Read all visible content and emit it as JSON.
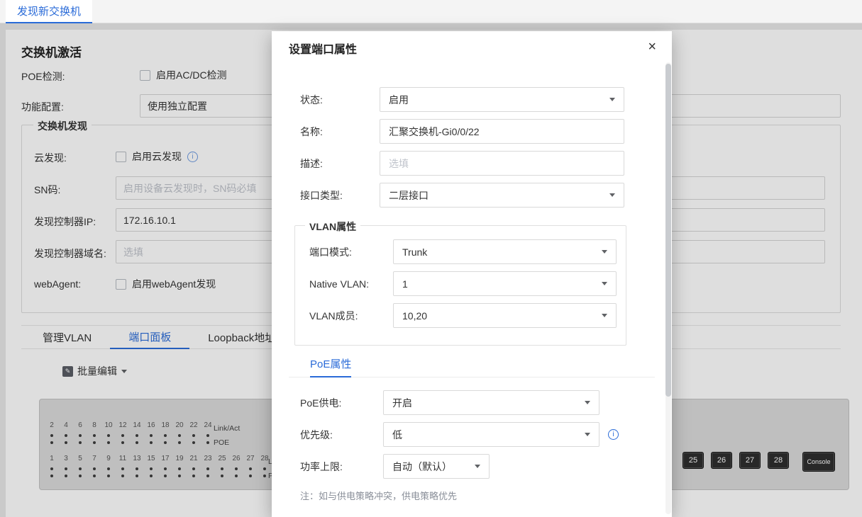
{
  "colors": {
    "accent": "#2a6bd8"
  },
  "icons": {
    "info_glyph": "i",
    "edit_glyph": "✎"
  },
  "topbar": {
    "tab_label": "发现新交换机"
  },
  "page": {
    "title": "交换机激活",
    "rows": {
      "poe": {
        "label": "POE检测:",
        "checkbox_label": "启用AC/DC检测"
      },
      "func": {
        "label": "功能配置:",
        "value": "使用独立配置"
      },
      "cloud": {
        "label": "云发现:",
        "checkbox_label": "启用云发现"
      },
      "sn": {
        "label": "SN码:",
        "placeholder": "启用设备云发现时，SN码必填"
      },
      "controller_ip": {
        "label": "发现控制器IP:",
        "value": "172.16.10.1"
      },
      "controller_domain": {
        "label": "发现控制器域名:",
        "placeholder": "选填"
      },
      "webagent": {
        "label": "webAgent:",
        "checkbox_label": "启用webAgent发现"
      }
    },
    "discovery_legend": "交换机发现",
    "tabs": [
      {
        "label": "管理VLAN"
      },
      {
        "label": "端口面板"
      },
      {
        "label": "Loopback地址"
      }
    ],
    "active_tab": "端口面板",
    "bulk_edit_label": "批量编辑",
    "port_panel": {
      "top_ports": [
        "2",
        "4",
        "6",
        "8",
        "10",
        "12",
        "14",
        "16",
        "18",
        "20",
        "22",
        "24"
      ],
      "bottom_ports": [
        "1",
        "3",
        "5",
        "7",
        "9",
        "11",
        "13",
        "15",
        "17",
        "19",
        "21",
        "23",
        "25",
        "26",
        "27",
        "28"
      ],
      "link_label": "Link/Act",
      "poe_label": "POE",
      "uplink_ports": [
        "25",
        "26",
        "27",
        "28"
      ],
      "console_label": "Console"
    }
  },
  "modal": {
    "title": "设置端口属性",
    "close_label": "×",
    "status": {
      "label": "状态:",
      "value": "启用"
    },
    "name": {
      "label": "名称:",
      "value": "汇聚交换机-Gi0/0/22"
    },
    "desc": {
      "label": "描述:",
      "placeholder": "选填"
    },
    "iface_type": {
      "label": "接口类型:",
      "value": "二层接口"
    },
    "vlan": {
      "legend": "VLAN属性",
      "port_mode": {
        "label": "端口模式:",
        "value": "Trunk"
      },
      "native_vlan": {
        "label": "Native VLAN:",
        "value": "1"
      },
      "vlan_members": {
        "label": "VLAN成员:",
        "value": "10,20"
      }
    },
    "poe": {
      "tab_label": "PoE属性",
      "supply": {
        "label": "PoE供电:",
        "value": "开启"
      },
      "priority": {
        "label": "优先级:",
        "value": "低"
      },
      "power_limit": {
        "label": "功率上限:",
        "value": "自动（默认）"
      },
      "note": "注：如与供电策略冲突，供电策略优先"
    }
  }
}
